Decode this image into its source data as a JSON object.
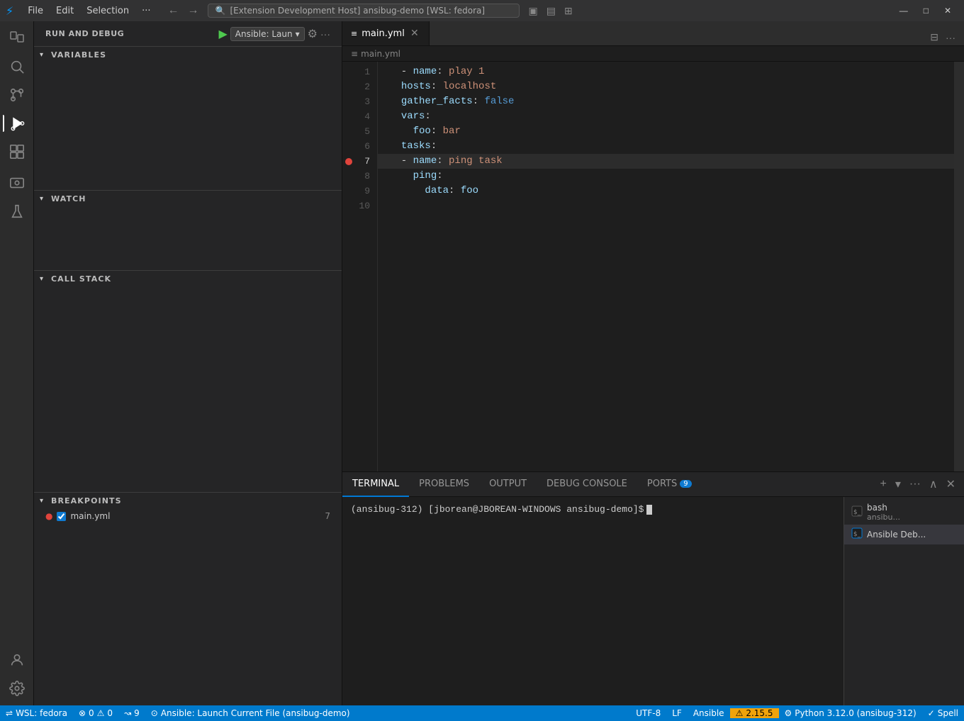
{
  "titlebar": {
    "logo": "⚡",
    "menu_items": [
      "File",
      "Edit",
      "Selection",
      "···"
    ],
    "nav_back": "←",
    "nav_forward": "→",
    "search_text": "[Extension Development Host] ansibug-demo [WSL: fedora]",
    "layout_btn1": "▣",
    "layout_btn2": "▤",
    "layout_btn3": "▦",
    "layout_btn4": "⊞",
    "win_min": "—",
    "win_max": "□",
    "win_close": "✕"
  },
  "activity_bar": {
    "icons": [
      {
        "name": "explorer-icon",
        "symbol": "⎘",
        "active": false
      },
      {
        "name": "search-icon",
        "symbol": "🔍",
        "active": false
      },
      {
        "name": "source-control-icon",
        "symbol": "⎇",
        "active": false
      },
      {
        "name": "run-debug-icon",
        "symbol": "▷",
        "active": true
      },
      {
        "name": "extensions-icon",
        "symbol": "⊞",
        "active": false
      },
      {
        "name": "remote-explorer-icon",
        "symbol": "⊙",
        "active": false
      },
      {
        "name": "flask-icon",
        "symbol": "⚗",
        "active": false
      },
      {
        "name": "account-icon",
        "symbol": "👤",
        "active": false
      },
      {
        "name": "settings-icon",
        "symbol": "⚙",
        "active": false
      }
    ]
  },
  "sidebar": {
    "header": {
      "label": "RUN AND DEBUG",
      "play_btn": "▶",
      "config_label": "Ansible: Laun",
      "chevron": "▾",
      "gear_icon": "⚙",
      "ellipsis": "···"
    },
    "variables_section": {
      "title": "VARIABLES",
      "chevron": "▾",
      "expanded": true
    },
    "watch_section": {
      "title": "WATCH",
      "chevron": "▾",
      "expanded": true
    },
    "callstack_section": {
      "title": "CALL STACK",
      "chevron": "▾",
      "expanded": true
    },
    "breakpoints_section": {
      "title": "BREAKPOINTS",
      "chevron": "▾",
      "expanded": true,
      "items": [
        {
          "dot": "●",
          "checked": true,
          "filename": "main.yml",
          "line": "7"
        }
      ]
    }
  },
  "editor": {
    "tab": {
      "icon": "≡",
      "filename": "main.yml",
      "close_btn": "✕"
    },
    "breadcrumb": {
      "icon": "≡",
      "filename": "main.yml"
    },
    "lines": [
      {
        "num": "1",
        "content": "  - name: play 1",
        "parts": [
          {
            "text": "  - ",
            "class": "dash"
          },
          {
            "text": "name",
            "class": "key"
          },
          {
            "text": ": ",
            "class": "colon"
          },
          {
            "text": "play 1",
            "class": "val-string"
          }
        ]
      },
      {
        "num": "2",
        "content": "  hosts: localhost",
        "parts": [
          {
            "text": "  ",
            "class": "indent"
          },
          {
            "text": "hosts",
            "class": "key"
          },
          {
            "text": ": ",
            "class": "colon"
          },
          {
            "text": "localhost",
            "class": "val-string"
          }
        ]
      },
      {
        "num": "3",
        "content": "  gather_facts: false",
        "parts": [
          {
            "text": "  ",
            "class": "indent"
          },
          {
            "text": "gather_facts",
            "class": "key"
          },
          {
            "text": ": ",
            "class": "colon"
          },
          {
            "text": "false",
            "class": "val-bool"
          }
        ]
      },
      {
        "num": "4",
        "content": "  vars:",
        "parts": [
          {
            "text": "  ",
            "class": "indent"
          },
          {
            "text": "vars",
            "class": "key"
          },
          {
            "text": ":",
            "class": "colon"
          }
        ]
      },
      {
        "num": "5",
        "content": "    foo: bar",
        "parts": [
          {
            "text": "    ",
            "class": "indent"
          },
          {
            "text": "foo",
            "class": "key"
          },
          {
            "text": ": ",
            "class": "colon"
          },
          {
            "text": "bar",
            "class": "val-string"
          }
        ]
      },
      {
        "num": "6",
        "content": "  tasks:",
        "parts": [
          {
            "text": "  ",
            "class": "indent"
          },
          {
            "text": "tasks",
            "class": "key"
          },
          {
            "text": ":",
            "class": "colon"
          }
        ]
      },
      {
        "num": "7",
        "content": "  - name: ping task",
        "parts": [
          {
            "text": "  - ",
            "class": "dash"
          },
          {
            "text": "name",
            "class": "key"
          },
          {
            "text": ": ",
            "class": "colon"
          },
          {
            "text": "ping task",
            "class": "val-string"
          }
        ],
        "breakpoint": true
      },
      {
        "num": "8",
        "content": "    ping:",
        "parts": [
          {
            "text": "    ",
            "class": "indent"
          },
          {
            "text": "ping",
            "class": "key"
          },
          {
            "text": ":",
            "class": "colon"
          }
        ]
      },
      {
        "num": "9",
        "content": "      data: foo",
        "parts": [
          {
            "text": "      ",
            "class": "indent"
          },
          {
            "text": "data",
            "class": "key"
          },
          {
            "text": ": ",
            "class": "colon"
          },
          {
            "text": "foo",
            "class": "val-var"
          }
        ]
      },
      {
        "num": "10",
        "content": "",
        "parts": []
      }
    ]
  },
  "bottom_panel": {
    "tabs": [
      {
        "label": "TERMINAL",
        "active": true,
        "badge": null
      },
      {
        "label": "PROBLEMS",
        "active": false,
        "badge": null
      },
      {
        "label": "OUTPUT",
        "active": false,
        "badge": null
      },
      {
        "label": "DEBUG CONSOLE",
        "active": false,
        "badge": null
      },
      {
        "label": "PORTS",
        "active": false,
        "badge": "9"
      }
    ],
    "terminal_prompt": "(ansibug-312) [jborean@JBOREAN-WINDOWS ansibug-demo]$ ",
    "sessions": [
      {
        "icon": "⬛",
        "name": "bash",
        "sub": "ansibu...",
        "active": false
      },
      {
        "icon": "⬛",
        "name": "Ansible Deb...",
        "sub": "",
        "active": true
      }
    ],
    "add_btn": "+",
    "chevron_btn": "▾",
    "ellipsis_btn": "···",
    "up_btn": "∧",
    "close_btn": "✕"
  },
  "status_bar": {
    "wsl_icon": "⇌",
    "wsl_label": "WSL: fedora",
    "errors_icon": "⊗",
    "errors": "0",
    "warnings_icon": "⚠",
    "warnings": "0",
    "remote_icon": "↝",
    "remote_count": "9",
    "debug_icon": "⊙",
    "debug_label": "Ansible: Launch Current File (ansibug-demo)",
    "encoding": "UTF-8",
    "line_ending": "LF",
    "language": "Ansible",
    "warning_icon": "⚠",
    "version": "2.15.5",
    "python_icon": "⚙",
    "python_label": "Python 3.12.0 (ansibug-312)",
    "spell_icon": "✓",
    "spell_label": "Spell"
  }
}
